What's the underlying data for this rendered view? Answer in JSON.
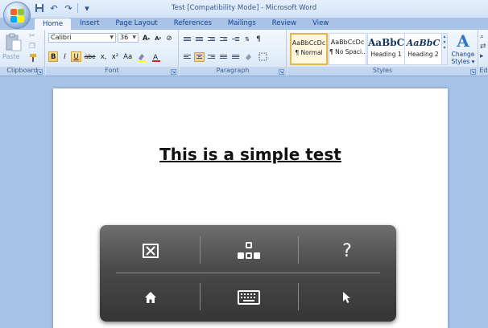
{
  "window": {
    "title": "Test [Compatibility Mode] - Microsoft Word"
  },
  "tabs": [
    "Home",
    "Insert",
    "Page Layout",
    "References",
    "Mailings",
    "Review",
    "View"
  ],
  "ribbon": {
    "clipboard": {
      "label": "Clipboard",
      "paste_label": "Paste"
    },
    "font": {
      "label": "Font",
      "font_name": "Calibri",
      "font_size": "36",
      "bold": "B",
      "italic": "I",
      "underline": "U",
      "strike": "abe",
      "subscript": "x,",
      "superscript": "x²",
      "change_case": "Aa"
    },
    "paragraph": {
      "label": "Paragraph"
    },
    "styles": {
      "label": "Styles",
      "items": [
        {
          "sample": "AaBbCcDc",
          "name": "¶ Normal"
        },
        {
          "sample": "AaBbCcDc",
          "name": "¶ No Spaci..."
        },
        {
          "sample": "AaBbC",
          "name": "Heading 1"
        },
        {
          "sample": "AaBbC",
          "name": "Heading 2"
        }
      ],
      "change_styles_line1": "Change",
      "change_styles_line2": "Styles ▾"
    },
    "editing": {
      "label": "Ed"
    }
  },
  "document": {
    "text": "This is a simple test"
  },
  "overlay": {
    "close": "⊠",
    "help": "?"
  },
  "colors": {
    "ribbon_bg": "#e4eefa",
    "overlay_bg": "#4a4a4a",
    "accent": "#2f74c8"
  }
}
